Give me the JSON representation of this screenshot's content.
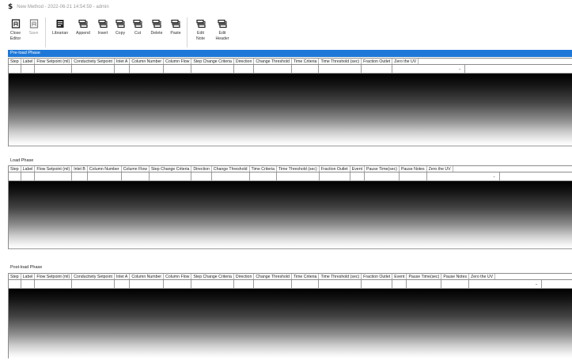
{
  "window": {
    "title": "New Method - 2022-06-21 14:54:59 - admin",
    "app_icon": "app-logo-icon"
  },
  "toolbar": {
    "groups": [
      [
        {
          "label": "Close\nEditor",
          "icon": "close-editor-icon",
          "disabled": false
        },
        {
          "label": "Save",
          "icon": "save-icon",
          "disabled": true
        }
      ],
      [
        {
          "label": "Librarian",
          "icon": "librarian-icon",
          "disabled": false
        },
        {
          "label": "Append",
          "icon": "append-icon",
          "disabled": false
        },
        {
          "label": "Insert",
          "icon": "insert-icon",
          "disabled": false
        },
        {
          "label": "Copy",
          "icon": "copy-icon",
          "disabled": false
        },
        {
          "label": "Cut",
          "icon": "cut-icon",
          "disabled": false
        },
        {
          "label": "Delete",
          "icon": "delete-icon",
          "disabled": false
        },
        {
          "label": "Paste",
          "icon": "paste-icon",
          "disabled": false
        }
      ],
      [
        {
          "label": "Edit\nNote",
          "icon": "edit-note-icon",
          "disabled": false
        },
        {
          "label": "Edit\nHeader",
          "icon": "edit-header-icon",
          "disabled": false
        }
      ]
    ]
  },
  "sections": [
    {
      "title": "Pre-load Phase",
      "active": true,
      "columns": [
        "Step",
        "Label",
        "Flow Setpoint (ml)",
        "Conductivity Setpoint",
        "Inlet A",
        "Column Number",
        "Column Flow",
        "Step Change Criteria",
        "Direction",
        "Change Threshold",
        "Time Criteria",
        "Time Threshold (sec)",
        "Fraction Outlet",
        "Zero the UV"
      ]
    },
    {
      "title": "Load Phase",
      "active": false,
      "columns": [
        "Step",
        "Label",
        "Flow Setpoint (ml)",
        "Inlet B",
        "Column Number",
        "Column Flow",
        "Step Change Criteria",
        "Direction",
        "Change Threshold",
        "Time Criteria",
        "Time Threshold (sec)",
        "Fraction Outlet",
        "Event",
        "Pause Time(sec)",
        "Pause Notes",
        "Zero the UV"
      ]
    },
    {
      "title": "Post-load Phase",
      "active": false,
      "columns": [
        "Step",
        "Label",
        "Flow Setpoint (ml)",
        "Conductivity Setpoint",
        "Inlet A",
        "Column Number",
        "Column Flow",
        "Step Change Criteria",
        "Direction",
        "Change Threshold",
        "Time Criteria",
        "Time Threshold (sec)",
        "Fraction Outlet",
        "Event",
        "Pause Time(sec)",
        "Pause Notes",
        "Zero the UV"
      ]
    }
  ],
  "colors": {
    "selected_header": "#1e78d7",
    "grid_line": "#8c8c8c"
  }
}
